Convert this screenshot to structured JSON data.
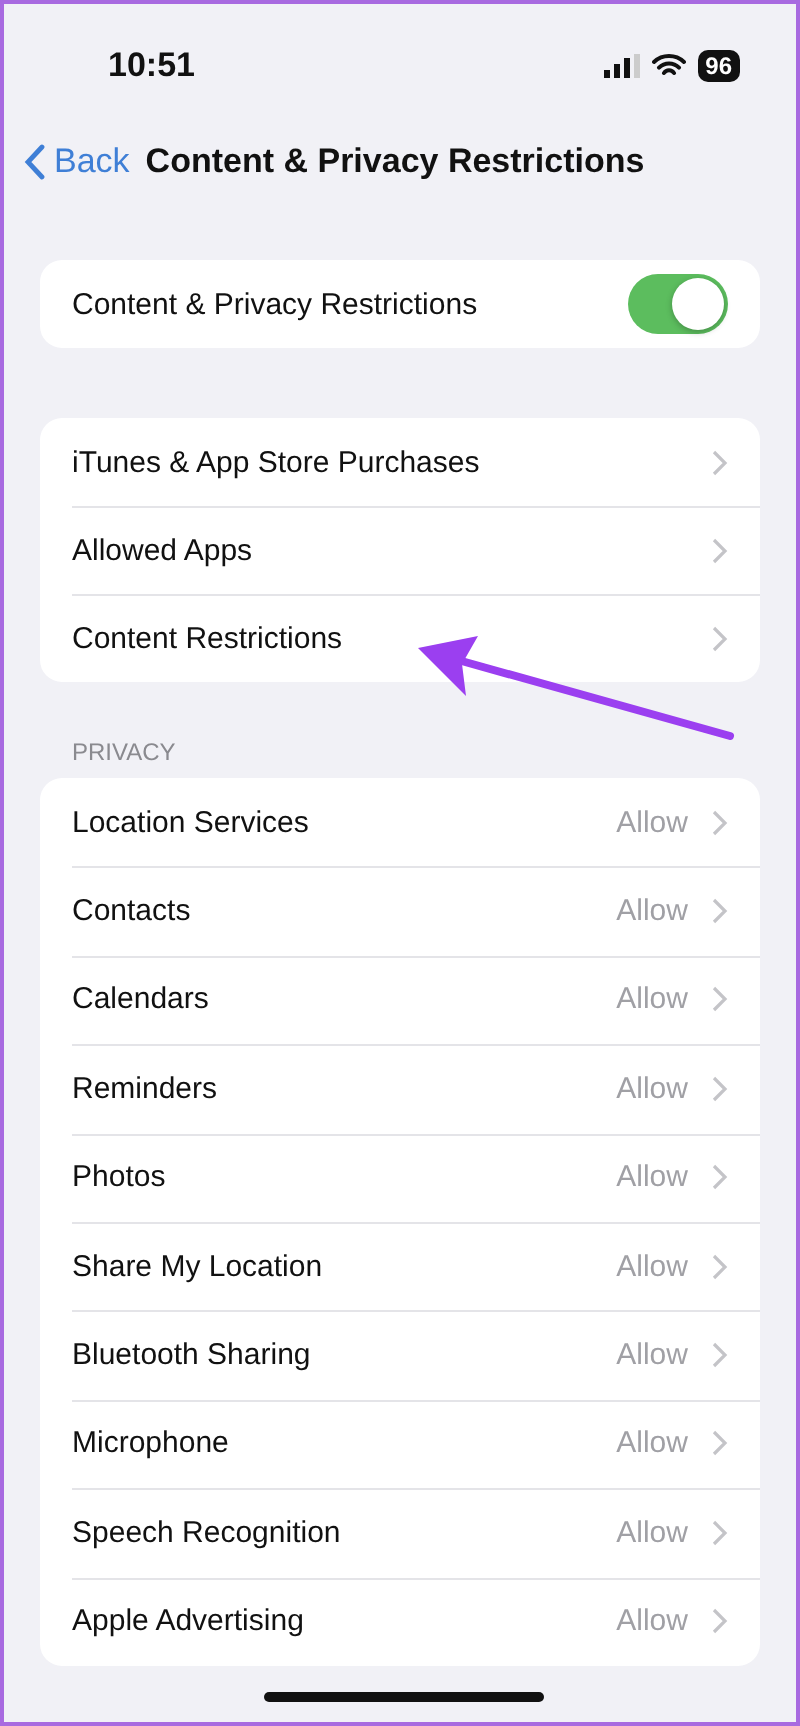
{
  "status_bar": {
    "time": "10:51",
    "battery": "96"
  },
  "nav": {
    "back": "Back",
    "title": "Content & Privacy Restrictions"
  },
  "toggle_row": {
    "label": "Content & Privacy Restrictions",
    "on": true
  },
  "restrictions": [
    {
      "label": "iTunes & App Store Purchases"
    },
    {
      "label": "Allowed Apps"
    },
    {
      "label": "Content Restrictions"
    }
  ],
  "privacy": {
    "header": "PRIVACY",
    "items": [
      {
        "label": "Location Services",
        "value": "Allow"
      },
      {
        "label": "Contacts",
        "value": "Allow"
      },
      {
        "label": "Calendars",
        "value": "Allow"
      },
      {
        "label": "Reminders",
        "value": "Allow"
      },
      {
        "label": "Photos",
        "value": "Allow"
      },
      {
        "label": "Share My Location",
        "value": "Allow"
      },
      {
        "label": "Bluetooth Sharing",
        "value": "Allow"
      },
      {
        "label": "Microphone",
        "value": "Allow"
      },
      {
        "label": "Speech Recognition",
        "value": "Allow"
      },
      {
        "label": "Apple Advertising",
        "value": "Allow"
      }
    ]
  }
}
